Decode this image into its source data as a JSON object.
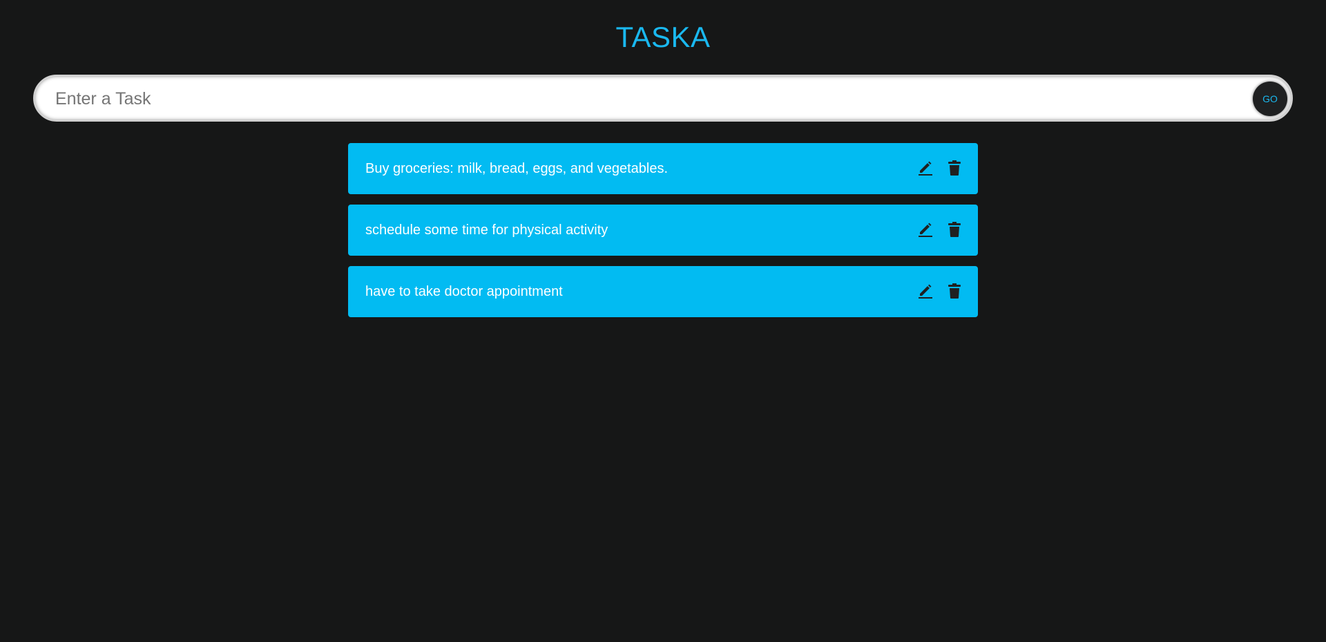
{
  "app": {
    "title": "TASKA"
  },
  "input": {
    "placeholder": "Enter a Task",
    "value": "",
    "go_label": "GO"
  },
  "tasks": [
    {
      "text": "Buy groceries: milk, bread, eggs, and vegetables.",
      "edit_icon": "pencil-icon",
      "delete_icon": "trash-icon"
    },
    {
      "text": "schedule some time for physical activity",
      "edit_icon": "pencil-icon",
      "delete_icon": "trash-icon"
    },
    {
      "text": "have to take doctor appointment",
      "edit_icon": "pencil-icon",
      "delete_icon": "trash-icon"
    }
  ],
  "colors": {
    "background": "#161717",
    "accent": "#1ab8ef",
    "task_background": "#02bbf2",
    "icon": "#1f2021"
  }
}
